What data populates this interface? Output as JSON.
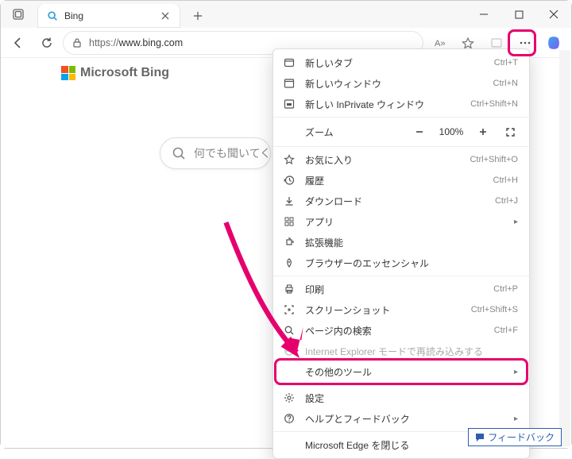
{
  "window": {
    "tab_title": "Bing"
  },
  "toolbar": {
    "url_scheme": "https://",
    "url_host": "www.bing.com"
  },
  "page": {
    "logo_text": "Microsoft Bing",
    "search_placeholder": "何でも聞いてください",
    "feedback_label": "フィードバック"
  },
  "menu": {
    "zoom_label": "ズーム",
    "zoom_value": "100%",
    "items": [
      {
        "icon": "tab",
        "label": "新しいタブ",
        "shortcut": "Ctrl+T"
      },
      {
        "icon": "window",
        "label": "新しいウィンドウ",
        "shortcut": "Ctrl+N"
      },
      {
        "icon": "inprivate",
        "label": "新しい InPrivate ウィンドウ",
        "shortcut": "Ctrl+Shift+N"
      }
    ],
    "items2": [
      {
        "icon": "star",
        "label": "お気に入り",
        "shortcut": "Ctrl+Shift+O"
      },
      {
        "icon": "history",
        "label": "履歴",
        "shortcut": "Ctrl+H"
      },
      {
        "icon": "download",
        "label": "ダウンロード",
        "shortcut": "Ctrl+J"
      },
      {
        "icon": "apps",
        "label": "アプリ",
        "submenu": true
      },
      {
        "icon": "ext",
        "label": "拡張機能"
      },
      {
        "icon": "essentials",
        "label": "ブラウザーのエッセンシャル"
      }
    ],
    "items3": [
      {
        "icon": "print",
        "label": "印刷",
        "shortcut": "Ctrl+P"
      },
      {
        "icon": "screenshot",
        "label": "スクリーンショット",
        "shortcut": "Ctrl+Shift+S"
      },
      {
        "icon": "find",
        "label": "ページ内の検索",
        "shortcut": "Ctrl+F"
      },
      {
        "icon": "ie",
        "label": "Internet Explorer モードで再読み込みする",
        "disabled": true
      },
      {
        "icon": "tools",
        "label": "その他のツール",
        "submenu": true
      }
    ],
    "items4": [
      {
        "icon": "gear",
        "label": "設定"
      },
      {
        "icon": "help",
        "label": "ヘルプとフィードバック",
        "submenu": true
      }
    ],
    "items5": [
      {
        "icon": "",
        "label": "Microsoft Edge を閉じる"
      }
    ]
  }
}
